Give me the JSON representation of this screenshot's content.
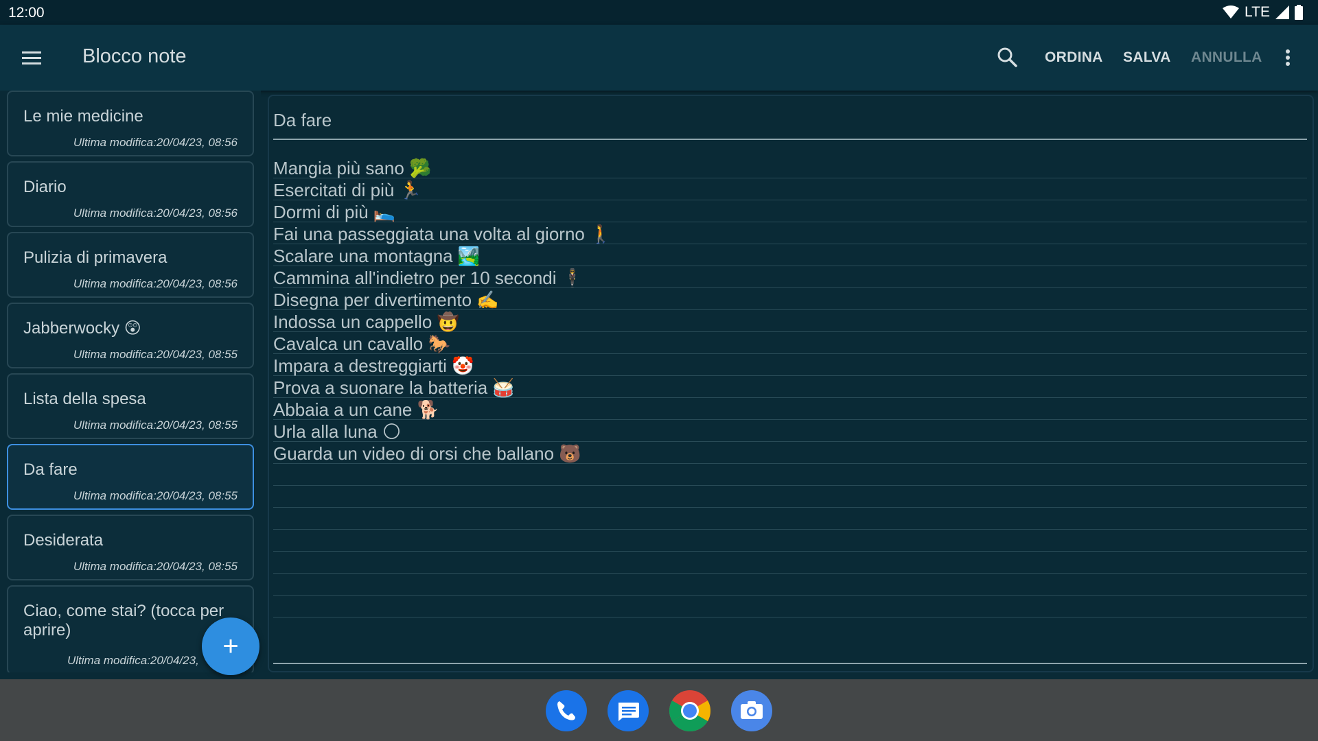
{
  "status_bar": {
    "time": "12:00",
    "network": "LTE",
    "icons": [
      "wifi-icon",
      "signal-icon",
      "battery-icon"
    ]
  },
  "app_bar": {
    "title": "Blocco note",
    "actions": {
      "sort": "ORDINA",
      "save": "SALVA",
      "cancel": "ANNULLA"
    },
    "icons": [
      "menu-icon",
      "search-icon",
      "overflow-menu-icon"
    ]
  },
  "notes": [
    {
      "title": "Le mie medicine",
      "date": "Ultima modifica:20/04/23, 08:56"
    },
    {
      "title": "Diario",
      "date": "Ultima modifica:20/04/23, 08:56"
    },
    {
      "title": "Pulizia di primavera",
      "date": "Ultima modifica:20/04/23, 08:56"
    },
    {
      "title": "Jabberwocky 😲",
      "date": "Ultima modifica:20/04/23, 08:55"
    },
    {
      "title": "Lista della spesa",
      "date": "Ultima modifica:20/04/23, 08:55"
    },
    {
      "title": "Da fare",
      "date": "Ultima modifica:20/04/23, 08:55",
      "selected": true
    },
    {
      "title": "Desiderata",
      "date": "Ultima modifica:20/04/23, 08:55"
    },
    {
      "title": "Ciao, come stai? (tocca per aprire)",
      "date": "Ultima modifica:20/04/23,"
    }
  ],
  "fab": {
    "label": "+"
  },
  "editor": {
    "title": "Da fare",
    "lines": [
      "Mangia più sano 🥦",
      "Esercitati di più 🏃",
      "Dormi di più 🛌",
      "Fai una passeggiata una volta al giorno 🚶",
      "Scalare una montagna 🏞️",
      "Cammina all'indietro per 10 secondi 🕴",
      "Disegna per divertimento ✍️",
      "Indossa un cappello 🤠",
      "Cavalca un cavallo 🐎",
      "Impara a destreggiarti 🤡",
      "Prova a suonare la batteria 🥁",
      "Abbaia a un cane 🐕",
      "Urla alla luna 🌕",
      "Guarda un video di orsi che ballano 🐻",
      "",
      "",
      "",
      "",
      "",
      "",
      "",
      ""
    ]
  },
  "dock": [
    "phone-icon",
    "messages-icon",
    "chrome-icon",
    "camera-icon"
  ],
  "colors": {
    "background": "#0a2a36",
    "app_bar": "#0b3342",
    "accent": "#2e8ee0",
    "selected_border": "#3d8fe0",
    "nav_bar": "#444748"
  }
}
